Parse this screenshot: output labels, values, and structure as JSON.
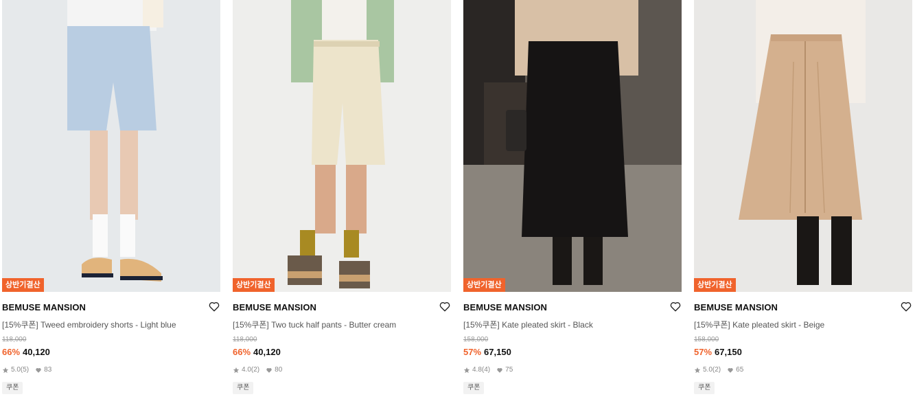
{
  "products": [
    {
      "badge": "상반기결산",
      "brand": "BEMUSE MANSION",
      "name": "[15%쿠폰] Tweed embroidery shorts - Light blue",
      "original_price": "118,000",
      "discount": "66%",
      "price": "40,120",
      "rating": "5.0",
      "reviews": "(5)",
      "likes": "83",
      "coupon": "쿠폰",
      "image": {
        "bg": "#e6e9eb",
        "garment": "#b9cde2",
        "garment_type": "shorts",
        "top": "#f4f4f4"
      }
    },
    {
      "badge": "상반기결산",
      "brand": "BEMUSE MANSION",
      "name": "[15%쿠폰] Two tuck half pants - Butter cream",
      "original_price": "118,000",
      "discount": "66%",
      "price": "40,120",
      "rating": "4.0",
      "reviews": "(2)",
      "likes": "80",
      "coupon": "쿠폰",
      "image": {
        "bg": "#eeeeec",
        "garment": "#ede4cb",
        "garment_type": "shorts",
        "top": "#a9c6a2"
      }
    },
    {
      "badge": "상반기결산",
      "brand": "BEMUSE MANSION",
      "name": "[15%쿠폰] Kate pleated skirt - Black",
      "original_price": "158,000",
      "discount": "57%",
      "price": "67,150",
      "rating": "4.8",
      "reviews": "(4)",
      "likes": "75",
      "coupon": "쿠폰",
      "image": {
        "bg": "#5c5650",
        "garment": "#161414",
        "garment_type": "skirt",
        "top": "#d8c0a6"
      }
    },
    {
      "badge": "상반기결산",
      "brand": "BEMUSE MANSION",
      "name": "[15%쿠폰] Kate pleated skirt - Beige",
      "original_price": "158,000",
      "discount": "57%",
      "price": "67,150",
      "rating": "5.0",
      "reviews": "(2)",
      "likes": "65",
      "coupon": "쿠폰",
      "image": {
        "bg": "#e9e8e6",
        "garment": "#d4b08e",
        "garment_type": "skirt",
        "top": "#f3eee8"
      }
    }
  ],
  "colors": {
    "accent": "#f0632c",
    "text": "#111111",
    "muted": "#888888"
  }
}
